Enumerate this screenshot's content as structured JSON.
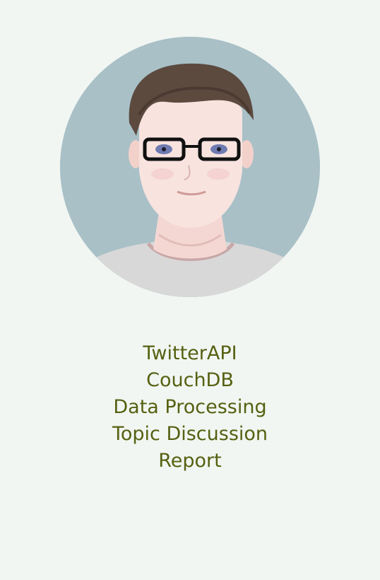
{
  "profile": {
    "avatar_icon": "cartoon-portrait-with-glasses"
  },
  "menu": {
    "items": [
      {
        "label": "TwitterAPI"
      },
      {
        "label": "CouchDB"
      },
      {
        "label": "Data Processing"
      },
      {
        "label": "Topic Discussion"
      },
      {
        "label": "Report"
      }
    ]
  },
  "colors": {
    "background": "#f1f6f2",
    "avatar_background": "#a9c0c7",
    "menu_text": "#566011"
  }
}
